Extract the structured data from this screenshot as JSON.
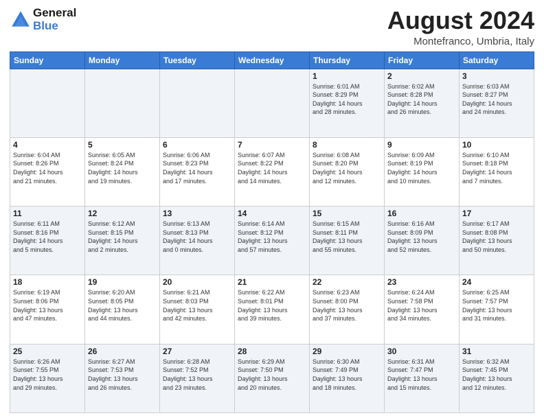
{
  "header": {
    "logo_line1": "General",
    "logo_line2": "Blue",
    "month_title": "August 2024",
    "location": "Montefranco, Umbria, Italy"
  },
  "weekdays": [
    "Sunday",
    "Monday",
    "Tuesday",
    "Wednesday",
    "Thursday",
    "Friday",
    "Saturday"
  ],
  "weeks": [
    [
      {
        "day": "",
        "info": ""
      },
      {
        "day": "",
        "info": ""
      },
      {
        "day": "",
        "info": ""
      },
      {
        "day": "",
        "info": ""
      },
      {
        "day": "1",
        "info": "Sunrise: 6:01 AM\nSunset: 8:29 PM\nDaylight: 14 hours\nand 28 minutes."
      },
      {
        "day": "2",
        "info": "Sunrise: 6:02 AM\nSunset: 8:28 PM\nDaylight: 14 hours\nand 26 minutes."
      },
      {
        "day": "3",
        "info": "Sunrise: 6:03 AM\nSunset: 8:27 PM\nDaylight: 14 hours\nand 24 minutes."
      }
    ],
    [
      {
        "day": "4",
        "info": "Sunrise: 6:04 AM\nSunset: 8:26 PM\nDaylight: 14 hours\nand 21 minutes."
      },
      {
        "day": "5",
        "info": "Sunrise: 6:05 AM\nSunset: 8:24 PM\nDaylight: 14 hours\nand 19 minutes."
      },
      {
        "day": "6",
        "info": "Sunrise: 6:06 AM\nSunset: 8:23 PM\nDaylight: 14 hours\nand 17 minutes."
      },
      {
        "day": "7",
        "info": "Sunrise: 6:07 AM\nSunset: 8:22 PM\nDaylight: 14 hours\nand 14 minutes."
      },
      {
        "day": "8",
        "info": "Sunrise: 6:08 AM\nSunset: 8:20 PM\nDaylight: 14 hours\nand 12 minutes."
      },
      {
        "day": "9",
        "info": "Sunrise: 6:09 AM\nSunset: 8:19 PM\nDaylight: 14 hours\nand 10 minutes."
      },
      {
        "day": "10",
        "info": "Sunrise: 6:10 AM\nSunset: 8:18 PM\nDaylight: 14 hours\nand 7 minutes."
      }
    ],
    [
      {
        "day": "11",
        "info": "Sunrise: 6:11 AM\nSunset: 8:16 PM\nDaylight: 14 hours\nand 5 minutes."
      },
      {
        "day": "12",
        "info": "Sunrise: 6:12 AM\nSunset: 8:15 PM\nDaylight: 14 hours\nand 2 minutes."
      },
      {
        "day": "13",
        "info": "Sunrise: 6:13 AM\nSunset: 8:13 PM\nDaylight: 14 hours\nand 0 minutes."
      },
      {
        "day": "14",
        "info": "Sunrise: 6:14 AM\nSunset: 8:12 PM\nDaylight: 13 hours\nand 57 minutes."
      },
      {
        "day": "15",
        "info": "Sunrise: 6:15 AM\nSunset: 8:11 PM\nDaylight: 13 hours\nand 55 minutes."
      },
      {
        "day": "16",
        "info": "Sunrise: 6:16 AM\nSunset: 8:09 PM\nDaylight: 13 hours\nand 52 minutes."
      },
      {
        "day": "17",
        "info": "Sunrise: 6:17 AM\nSunset: 8:08 PM\nDaylight: 13 hours\nand 50 minutes."
      }
    ],
    [
      {
        "day": "18",
        "info": "Sunrise: 6:19 AM\nSunset: 8:06 PM\nDaylight: 13 hours\nand 47 minutes."
      },
      {
        "day": "19",
        "info": "Sunrise: 6:20 AM\nSunset: 8:05 PM\nDaylight: 13 hours\nand 44 minutes."
      },
      {
        "day": "20",
        "info": "Sunrise: 6:21 AM\nSunset: 8:03 PM\nDaylight: 13 hours\nand 42 minutes."
      },
      {
        "day": "21",
        "info": "Sunrise: 6:22 AM\nSunset: 8:01 PM\nDaylight: 13 hours\nand 39 minutes."
      },
      {
        "day": "22",
        "info": "Sunrise: 6:23 AM\nSunset: 8:00 PM\nDaylight: 13 hours\nand 37 minutes."
      },
      {
        "day": "23",
        "info": "Sunrise: 6:24 AM\nSunset: 7:58 PM\nDaylight: 13 hours\nand 34 minutes."
      },
      {
        "day": "24",
        "info": "Sunrise: 6:25 AM\nSunset: 7:57 PM\nDaylight: 13 hours\nand 31 minutes."
      }
    ],
    [
      {
        "day": "25",
        "info": "Sunrise: 6:26 AM\nSunset: 7:55 PM\nDaylight: 13 hours\nand 29 minutes."
      },
      {
        "day": "26",
        "info": "Sunrise: 6:27 AM\nSunset: 7:53 PM\nDaylight: 13 hours\nand 26 minutes."
      },
      {
        "day": "27",
        "info": "Sunrise: 6:28 AM\nSunset: 7:52 PM\nDaylight: 13 hours\nand 23 minutes."
      },
      {
        "day": "28",
        "info": "Sunrise: 6:29 AM\nSunset: 7:50 PM\nDaylight: 13 hours\nand 20 minutes."
      },
      {
        "day": "29",
        "info": "Sunrise: 6:30 AM\nSunset: 7:49 PM\nDaylight: 13 hours\nand 18 minutes."
      },
      {
        "day": "30",
        "info": "Sunrise: 6:31 AM\nSunset: 7:47 PM\nDaylight: 13 hours\nand 15 minutes."
      },
      {
        "day": "31",
        "info": "Sunrise: 6:32 AM\nSunset: 7:45 PM\nDaylight: 13 hours\nand 12 minutes."
      }
    ]
  ]
}
